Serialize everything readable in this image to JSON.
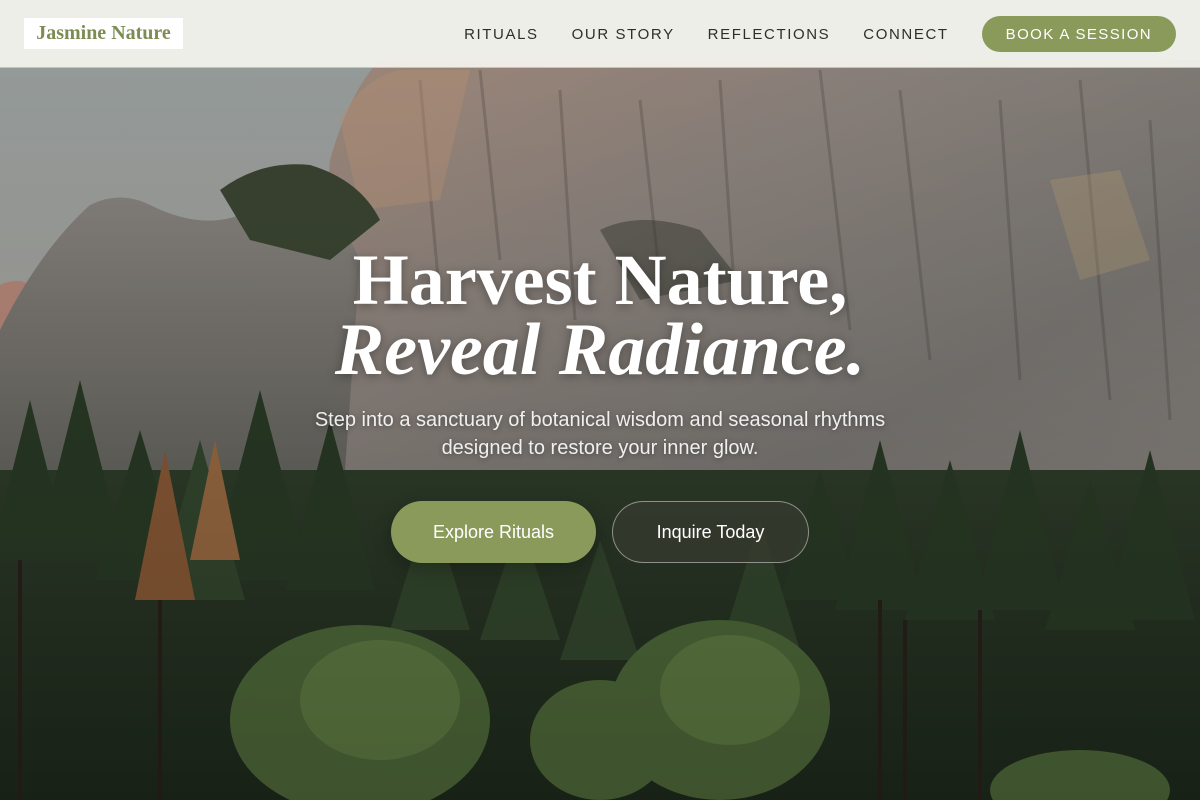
{
  "brand": {
    "name": "Jasmine Nature"
  },
  "nav": {
    "links": [
      "RITUALS",
      "OUR STORY",
      "REFLECTIONS",
      "CONNECT"
    ],
    "cta_label": "BOOK A SESSION"
  },
  "hero": {
    "headline_line1": "Harvest Nature,",
    "headline_line2": "Reveal Radiance.",
    "subtitle": "Step into a sanctuary of botanical wisdom and seasonal rhythms designed to restore your inner glow.",
    "primary_button": "Explore Rituals",
    "secondary_button": "Inquire Today",
    "background": "mountain-forest-image"
  },
  "colors": {
    "accent": "#8a9a5b",
    "logo_text": "#7d8c52",
    "header_bg": "#f5f4ee",
    "nav_text": "#2e2e2a"
  }
}
